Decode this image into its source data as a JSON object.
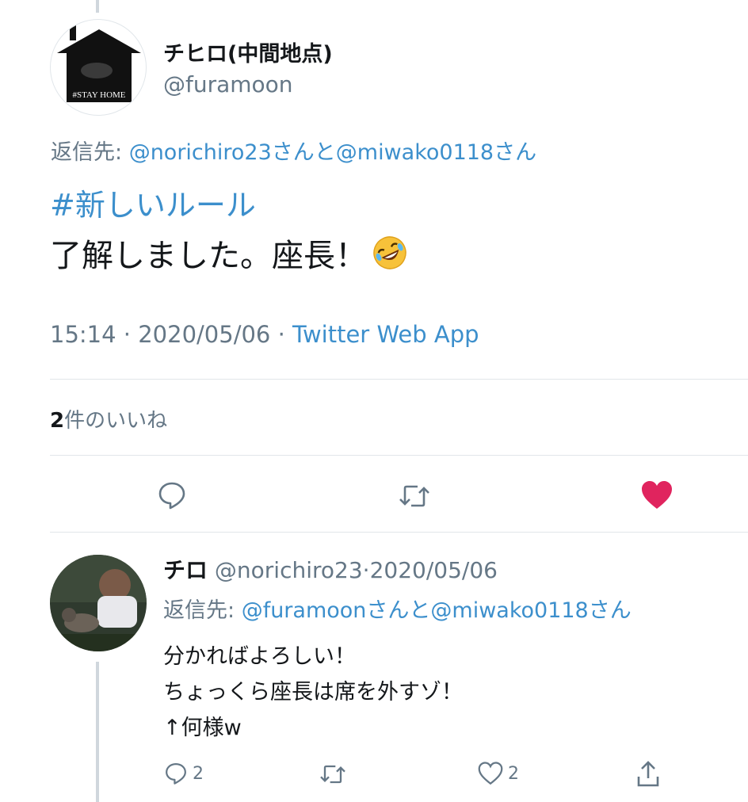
{
  "tweet": {
    "display_name": "チヒロ(中間地点)",
    "handle": "@furamoon",
    "avatar_text": "#STAY HOME",
    "reply_prefix": "返信先: ",
    "reply_users": "@norichiro23さんと@miwako0118さん",
    "hashtag": "#新しいルール",
    "text": "了解しました。座長！",
    "emoji": "rolling-on-floor-laughing-emoji",
    "time": "15:14 · 2020/05/06 · ",
    "source": "Twitter Web App",
    "likes_count": "2",
    "likes_label": "件のいいね"
  },
  "actions": {
    "reply_icon": "reply-icon",
    "retweet_icon": "retweet-icon",
    "like_icon": "heart-filled-icon",
    "like_color": "#e0245e"
  },
  "reply": {
    "display_name": "チロ",
    "handle": "@norichiro23",
    "date": "·2020/05/06",
    "reply_prefix": "返信先: ",
    "reply_users": "@furamoonさんと@miwako0118さん",
    "lines": [
      "分かればよろしい！",
      "ちょっくら座長は席を外すゾ！",
      "↑何様w"
    ],
    "reply_count": "2",
    "like_count": "2"
  },
  "colors": {
    "link": "#3c8fcc",
    "muted": "#657786",
    "text": "#14171a"
  }
}
